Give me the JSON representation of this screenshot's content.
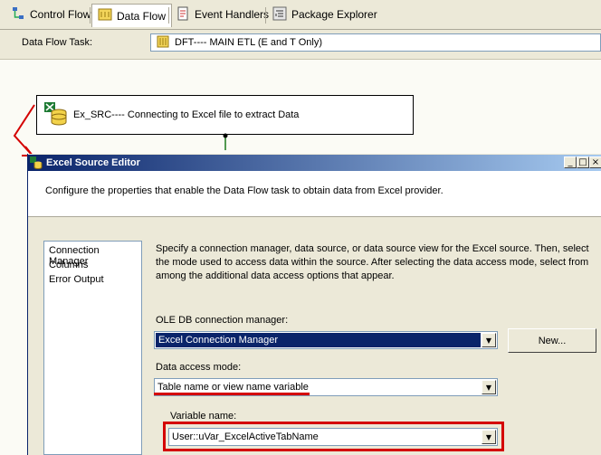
{
  "tabs": [
    {
      "label": "Control Flow",
      "icon": "control-flow-icon"
    },
    {
      "label": "Data Flow",
      "icon": "data-flow-icon",
      "active": true
    },
    {
      "label": "Event Handlers",
      "icon": "event-handlers-icon"
    },
    {
      "label": "Package Explorer",
      "icon": "package-explorer-icon"
    }
  ],
  "task_bar": {
    "label": "Data Flow Task:",
    "value": "DFT---- MAIN ETL (E and T Only)"
  },
  "component": {
    "label": "Ex_SRC---- Connecting to Excel file to extract Data",
    "icon": "excel-source-icon"
  },
  "dialog": {
    "title": "Excel Source Editor",
    "description": "Configure the properties that enable the Data Flow task to obtain data from Excel provider.",
    "nav": [
      "Connection Manager",
      "Columns",
      "Error Output"
    ],
    "help_text": "Specify a connection manager, data source, or data source view for the Excel source. Then, select the mode used to access data within the source. After selecting the data access mode, select from among the additional data access options that appear.",
    "connection_manager_label": "OLE DB connection manager:",
    "connection_manager_value": "Excel Connection Manager",
    "new_button": "New...",
    "access_mode_label": "Data access mode:",
    "access_mode_value": "Table name or view name variable",
    "variable_label": "Variable name:",
    "variable_value": "User::uVar_ExcelActiveTabName"
  },
  "colors": {
    "highlight": "#d40000",
    "titlebar": "#0a246a",
    "selection": "#0a246a"
  }
}
